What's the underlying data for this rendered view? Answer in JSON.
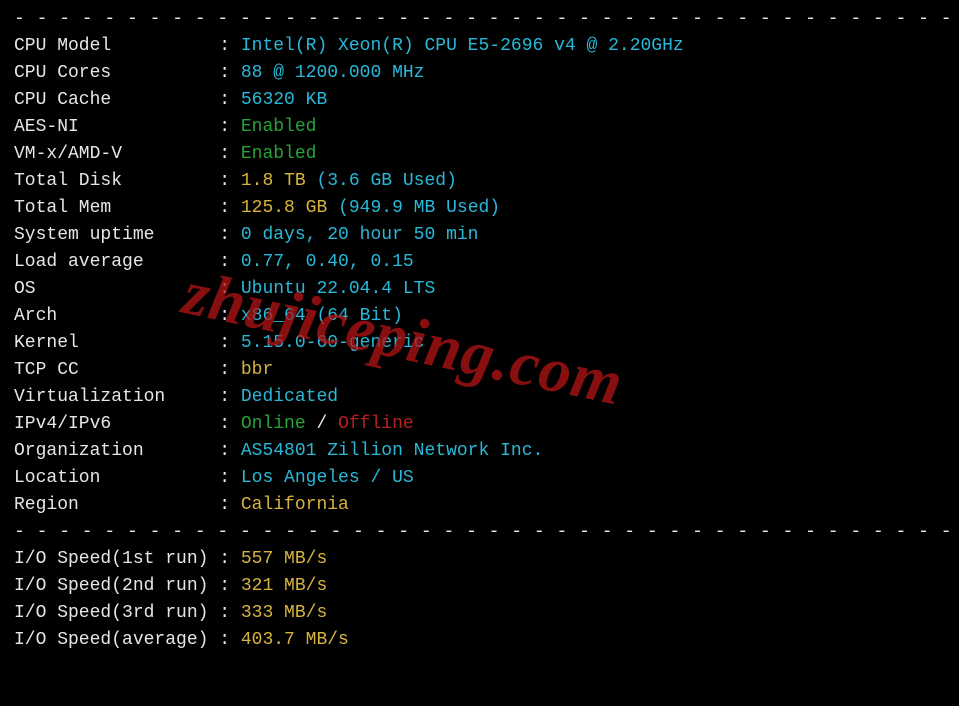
{
  "dashes_top": "- - - - - - - - - - - - - - - - - - - - - - - - - - - - - - - - - - - - - - - - - - -",
  "dashes_mid": "- - - - - - - - - - - - - - - - - - - - - - - - - - - - - - - - - - - - - - - - - - -",
  "fields": {
    "cpu_model": {
      "label": "CPU Model         ",
      "value": "Intel(R) Xeon(R) CPU E5-2696 v4 @ 2.20GHz",
      "color": "cyan"
    },
    "cpu_cores": {
      "label": "CPU Cores         ",
      "value": "88 @ 1200.000 MHz",
      "color": "cyan"
    },
    "cpu_cache": {
      "label": "CPU Cache         ",
      "value": "56320 KB",
      "color": "cyan"
    },
    "aes_ni": {
      "label": "AES-NI            ",
      "value": "Enabled",
      "color": "green"
    },
    "vmx": {
      "label": "VM-x/AMD-V        ",
      "value": "Enabled",
      "color": "green"
    },
    "total_disk": {
      "label": "Total Disk        ",
      "value1": "1.8 TB",
      "value2": " (3.6 GB Used)"
    },
    "total_mem": {
      "label": "Total Mem         ",
      "value1": "125.8 GB",
      "value2": " (949.9 MB Used)"
    },
    "uptime": {
      "label": "System uptime     ",
      "value": "0 days, 20 hour 50 min",
      "color": "cyan"
    },
    "load": {
      "label": "Load average      ",
      "value": "0.77, 0.40, 0.15",
      "color": "cyan"
    },
    "os": {
      "label": "OS                ",
      "value": "Ubuntu 22.04.4 LTS",
      "color": "cyan"
    },
    "arch": {
      "label": "Arch              ",
      "value": "x86_64 (64 Bit)",
      "color": "cyan"
    },
    "kernel": {
      "label": "Kernel            ",
      "value": "5.15.0-60-generic",
      "color": "cyan"
    },
    "tcp_cc": {
      "label": "TCP CC            ",
      "value": "bbr",
      "color": "yellow"
    },
    "virt": {
      "label": "Virtualization    ",
      "value": "Dedicated",
      "color": "cyan"
    },
    "ipv": {
      "label": "IPv4/IPv6         ",
      "online": "Online",
      "sep": " / ",
      "offline": "Offline"
    },
    "org": {
      "label": "Organization      ",
      "value": "AS54801 Zillion Network Inc.",
      "color": "cyan"
    },
    "location": {
      "label": "Location          ",
      "value": "Los Angeles / US",
      "color": "cyan"
    },
    "region": {
      "label": "Region            ",
      "value": "California",
      "color": "yellow"
    }
  },
  "io": {
    "r1": {
      "label": "I/O Speed(1st run)",
      "value": "557 MB/s"
    },
    "r2": {
      "label": "I/O Speed(2nd run)",
      "value": "321 MB/s"
    },
    "r3": {
      "label": "I/O Speed(3rd run)",
      "value": "333 MB/s"
    },
    "avg": {
      "label": "I/O Speed(average)",
      "value": "403.7 MB/s"
    }
  },
  "watermark": "zhujiceping.com"
}
